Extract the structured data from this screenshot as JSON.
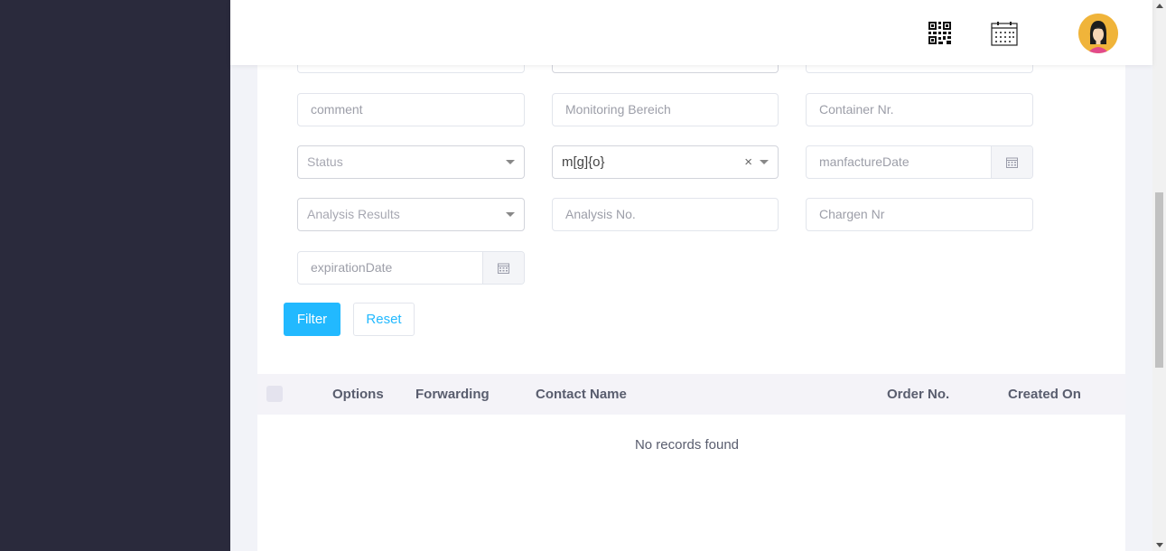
{
  "filters": {
    "row1": {
      "comment_placeholder": "comment",
      "monitoring_placeholder": "Monitoring Bereich",
      "container_placeholder": "Container Nr."
    },
    "row2": {
      "status_placeholder": "Status",
      "select_value": "m[g]{o}",
      "clear_symbol": "×",
      "manufacture_date_placeholder": "manfactureDate"
    },
    "row3": {
      "analysis_results_placeholder": "Analysis Results",
      "analysis_no_placeholder": "Analysis No.",
      "chargen_placeholder": "Chargen Nr"
    },
    "row4": {
      "expiration_date_placeholder": "expirationDate"
    },
    "filter_label": "Filter",
    "reset_label": "Reset"
  },
  "table": {
    "columns": [
      "Options",
      "Forwarding",
      "Contact Name",
      "Order No.",
      "Created On"
    ],
    "empty_message": "No records found"
  },
  "icons": {
    "qr": "qr-code-icon",
    "calendar": "calendar-icon",
    "avatar": "user-avatar"
  },
  "colors": {
    "sidebar": "#2a2a3c",
    "primary": "#22b9ff",
    "avatar_bg": "#f0b43a"
  }
}
